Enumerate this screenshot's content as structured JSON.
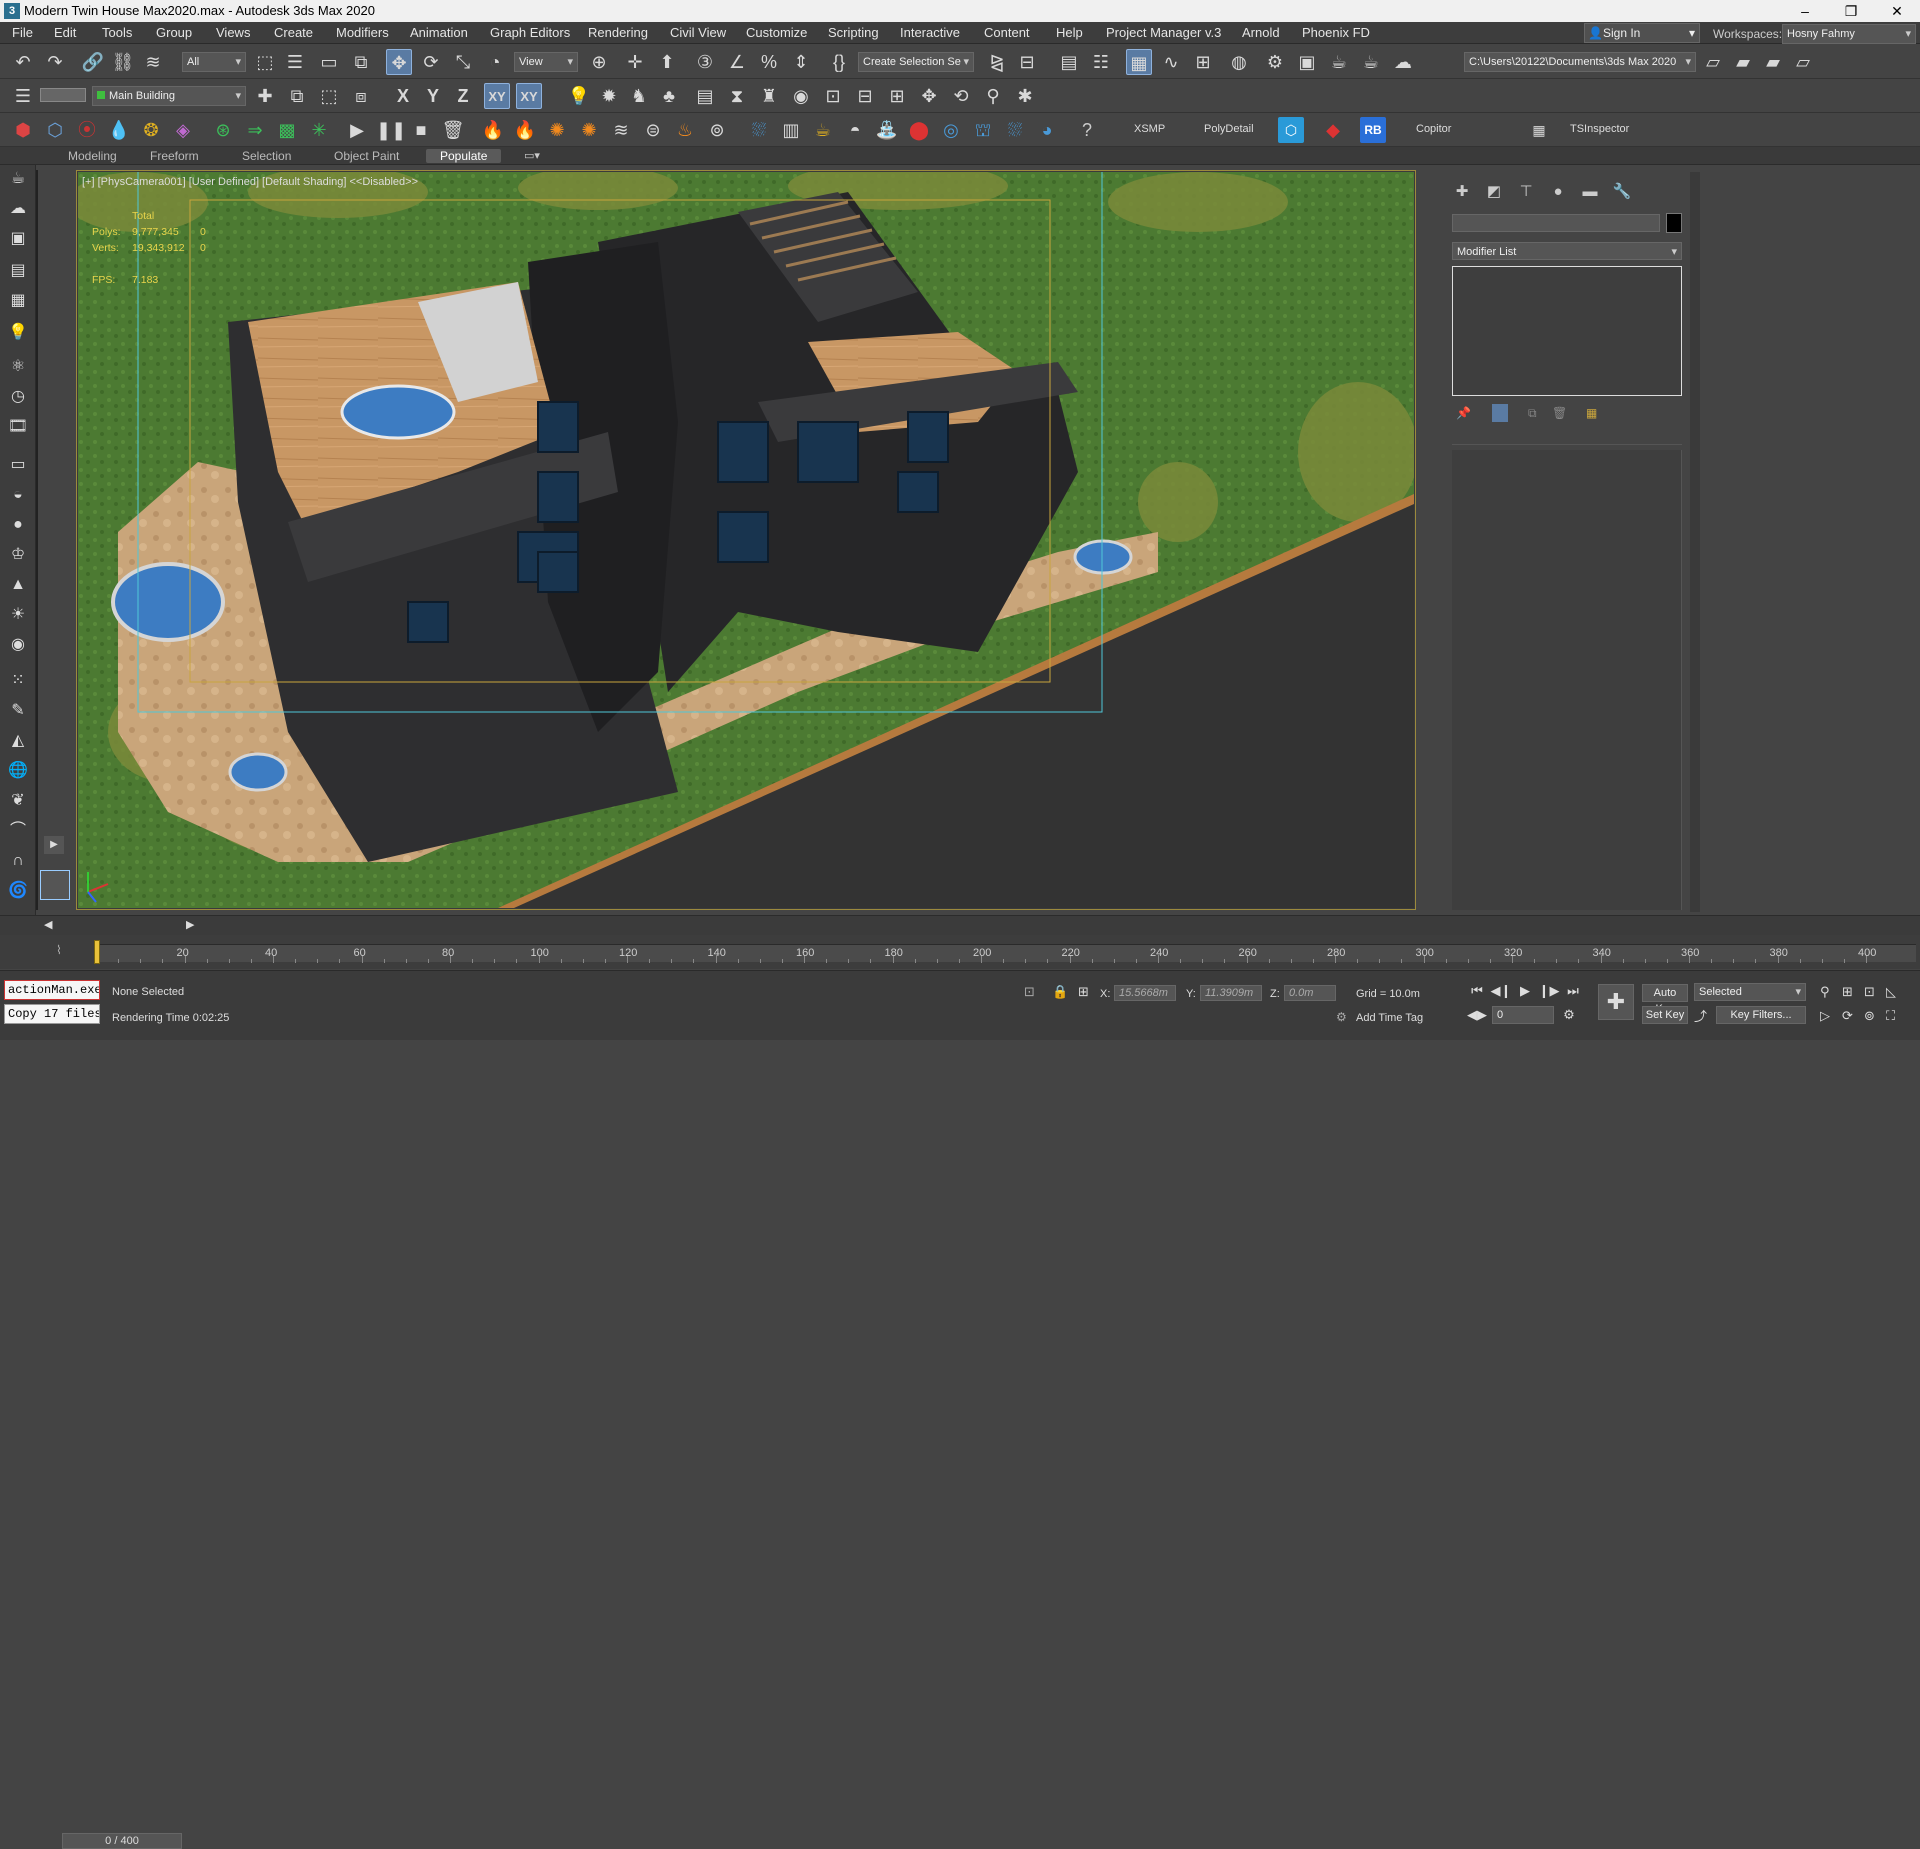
{
  "window": {
    "title": "Modern Twin House Max2020.max - Autodesk 3ds Max 2020",
    "logo": "3",
    "minimize": "–",
    "maximize": "❐",
    "close": "✕"
  },
  "menu": {
    "items": [
      "File",
      "Edit",
      "Tools",
      "Group",
      "Views",
      "Create",
      "Modifiers",
      "Animation",
      "Graph Editors",
      "Rendering",
      "Civil View",
      "Customize",
      "Scripting",
      "Interactive",
      "Content",
      "Help",
      "Project Manager v.3",
      "Arnold",
      "Phoenix FD"
    ]
  },
  "account": {
    "signin_label": "Sign In",
    "workspaces_label": "Workspaces:",
    "workspace_value": "Hosny Fahmy"
  },
  "main_toolbar": {
    "selection_filter": "All",
    "reference_coord": "View",
    "named_selection": "Create Selection Se",
    "project_path": "C:\\Users\\20122\\Documents\\3ds Max 2020",
    "axis_x": "X",
    "axis_y": "Y",
    "axis_z": "Z",
    "axis_xy": "XY",
    "axis_xy2": "XY"
  },
  "layer_toolbar": {
    "layer_name": "Main Building"
  },
  "plugin_toolbar": {
    "xsmp": "XSMP",
    "polydetail": "PolyDetail",
    "rb": "RB",
    "copitor": "Copitor",
    "tsinspector": "TSInspector"
  },
  "ribbon": {
    "tabs": [
      "Modeling",
      "Freeform",
      "Selection",
      "Object Paint",
      "Populate"
    ],
    "active": "Populate"
  },
  "viewport": {
    "label": "[+] [PhysCamera001] [User Defined] [Default Shading]  <<Disabled>>",
    "stats_total_label": "Total",
    "stats_polys_label": "Polys:",
    "stats_polys_value": "9,777,345",
    "stats_polys_sel": "0",
    "stats_verts_label": "Verts:",
    "stats_verts_value": "19,343,912",
    "stats_verts_sel": "0",
    "stats_fps_label": "FPS:",
    "stats_fps_value": "7.183"
  },
  "command_panel": {
    "modifier_list": "Modifier List"
  },
  "timeline": {
    "frame_display": "0 / 400",
    "ticks": [
      "20",
      "40",
      "60",
      "80",
      "100",
      "120",
      "140",
      "160",
      "180",
      "200",
      "220",
      "240",
      "260",
      "280",
      "300",
      "320",
      "340",
      "360",
      "380",
      "400"
    ],
    "current_frame": 0,
    "total_frames": 400
  },
  "status": {
    "maxscript_line1": "actionMan.exe",
    "maxscript_line2": "Copy 17 files",
    "selection_status": "None Selected",
    "rendering_time": "Rendering Time  0:02:25",
    "x_label": "X:",
    "x_value": "15.5668m",
    "y_label": "Y:",
    "y_value": "11.3909m",
    "z_label": "Z:",
    "z_value": "0.0m",
    "grid": "Grid = 10.0m",
    "add_time_tag": "Add Time Tag",
    "auto_key": "Auto Key",
    "selected_dropdown": "Selected",
    "set_key": "Set Key",
    "key_filters": "Key Filters...",
    "frame_field": "0"
  },
  "colors": {
    "accent": "#5a7ba3",
    "viewport_frame": "#9c8a3d",
    "safe_frame": "#4fc7d8",
    "stats_text": "#e9d54c",
    "grass": "#4c7a32",
    "roof_wood": "#c89764",
    "building": "#2e2e30",
    "pool": "#3d7cc2",
    "road": "#333333"
  }
}
